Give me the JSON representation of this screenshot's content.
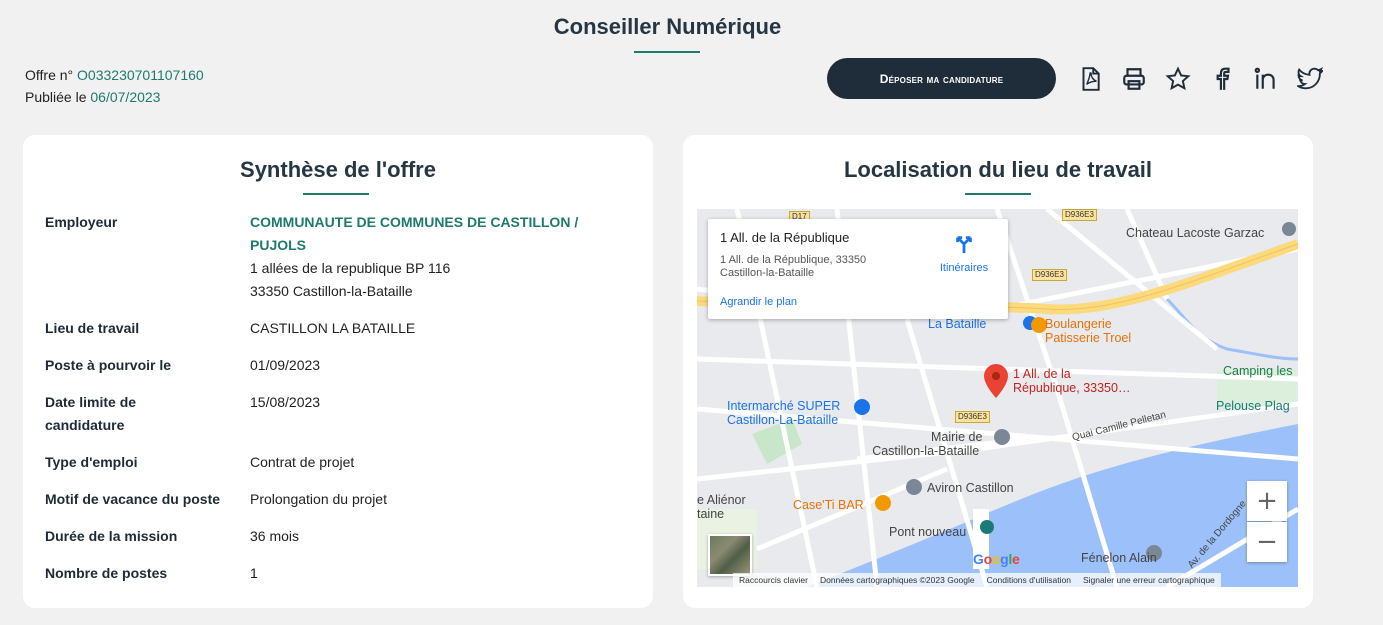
{
  "page": {
    "title": "Conseiller Numérique"
  },
  "offer": {
    "number_label": "Offre n°",
    "number": "O033230701107160",
    "published_label": "Publiée le",
    "published_date": "06/07/2023"
  },
  "actions": {
    "apply_label": "Déposer ma candidature",
    "icons": [
      "pdf-icon",
      "print-icon",
      "star-icon",
      "facebook-icon",
      "linkedin-icon",
      "twitter-icon"
    ]
  },
  "summary": {
    "title": "Synthèse de l'offre",
    "employer_label": "Employeur",
    "employer_name": "COMMUNAUTE DE COMMUNES DE CASTILLON / PUJOLS",
    "employer_address1": "1 allées de la republique BP 116",
    "employer_address2": "33350 Castillon-la-Bataille",
    "rows": [
      {
        "label": "Lieu de travail",
        "value": "CASTILLON LA BATAILLE"
      },
      {
        "label": "Poste à pourvoir le",
        "value": "01/09/2023"
      },
      {
        "label": "Date limite de candidature",
        "value": "15/08/2023"
      },
      {
        "label": "Type d'emploi",
        "value": "Contrat de projet"
      },
      {
        "label": "Motif de vacance du poste",
        "value": "Prolongation du projet"
      },
      {
        "label": "Durée de la mission",
        "value": "36 mois"
      },
      {
        "label": "Nombre de postes",
        "value": "1"
      }
    ]
  },
  "location": {
    "title": "Localisation du lieu de travail",
    "info": {
      "title": "1 All. de la République",
      "address_line1": "1 All. de la République, 33350",
      "address_line2": "Castillon-la-Bataille",
      "enlarge": "Agrandir le plan",
      "directions": "Itinéraires"
    },
    "labels": {
      "chateau": "Chateau Lacoste Garzac",
      "la_bataille": "La Bataille",
      "boulangerie1": "Boulangerie",
      "boulangerie2": "Patisserie Troel",
      "camping": "Camping les",
      "marker1": "1 All. de la",
      "marker2": "République, 33350…",
      "intermarche1": "Intermarché SUPER",
      "intermarche2": "Castillon-La-Bataille",
      "pelouse": "Pelouse Plag",
      "mairie1": "Mairie de",
      "mairie2": "Castillon-la-Bataille",
      "quai": "Quai Camille Pelletan",
      "alienor1": "e Aliénor",
      "alienor2": "taine",
      "aviron": "Aviron Castillon",
      "caseti": "Case'Ti BAR",
      "pont": "Pont nouveau",
      "fenelon": "Fénelon Alain",
      "av_dordogne": "Av. de la Dordogne",
      "roads": [
        "D17",
        "D936E3",
        "D936E3",
        "D936E3"
      ]
    },
    "attribution": {
      "shortcuts": "Raccourcis clavier",
      "data": "Données cartographiques ©2023 Google",
      "terms": "Conditions d'utilisation",
      "report": "Signaler une erreur cartographique",
      "google": "Google"
    },
    "zoom_in": "+",
    "zoom_out": "−"
  },
  "colors": {
    "accent": "#1f7a6d",
    "button_bg": "#1f2d3a",
    "page_bg": "#f1f1f1",
    "river": "#9cc0f9",
    "main_road": "#fbd97d"
  }
}
